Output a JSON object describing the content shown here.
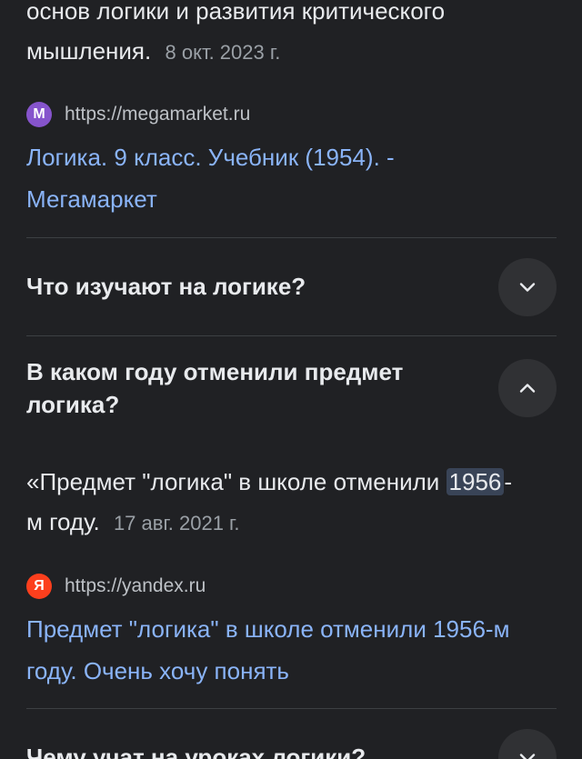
{
  "answer1": {
    "line1": "основ логики и развития критического",
    "line2": "мышления.",
    "date": "8 окт. 2023 г."
  },
  "source1": {
    "favicon_letter": "M",
    "favicon_color": "#8654cc",
    "url": "https://megamarket.ru",
    "title_line1": "Логика. 9 класс. Учебник (1954). -",
    "title_line2": "Мегамаркет"
  },
  "questions": [
    {
      "text": "Что изучают на логике?",
      "expanded": false
    },
    {
      "text_line1": "В каком году отменили предмет",
      "text_line2": "логика?",
      "expanded": true
    },
    {
      "text": "Чему учат на уроках логики?",
      "expanded": false
    }
  ],
  "answer2": {
    "before": "«Предмет \"логика\" в школе отменили",
    "highlight": "1956",
    "after": "-",
    "line2": "м году.",
    "date": "17 авг. 2021 г."
  },
  "source2": {
    "favicon_letter": "Я",
    "favicon_color": "#fc3f1d",
    "url": "https://yandex.ru",
    "title_line1": "Предмет \"логика\" в школе отменили 1956-м",
    "title_line2": "году. Очень хочу понять"
  },
  "colors": {
    "background": "#202124",
    "link": "#8ab4f8",
    "highlight": "#394457"
  }
}
